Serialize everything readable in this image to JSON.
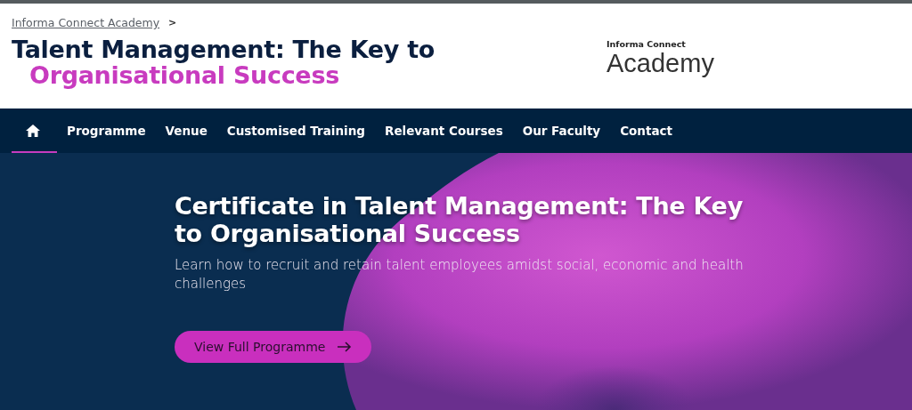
{
  "breadcrumb": {
    "link": "Informa Connect Academy",
    "separator": ">"
  },
  "page_title": {
    "main": "Talent Management: The Key to",
    "highlight": "Organisational Success"
  },
  "logo": {
    "top": "Informa Connect",
    "bottom": "Academy"
  },
  "nav": {
    "items": [
      {
        "kind": "home",
        "selected": true
      },
      {
        "kind": "text",
        "label": "Programme",
        "selected": false
      },
      {
        "kind": "text",
        "label": "Venue",
        "selected": false
      },
      {
        "kind": "text",
        "label": "Customised Training",
        "selected": false
      },
      {
        "kind": "text",
        "label": "Relevant Courses",
        "selected": false
      },
      {
        "kind": "text",
        "label": "Our Faculty",
        "selected": false
      },
      {
        "kind": "text",
        "label": "Contact",
        "selected": false
      }
    ]
  },
  "hero": {
    "heading": "Certificate in Talent Management: The Key to Organisational Success",
    "subheading": "Learn how to recruit and retain talent employees amidst social, economic and health challenges",
    "button": "View Full Programme"
  }
}
